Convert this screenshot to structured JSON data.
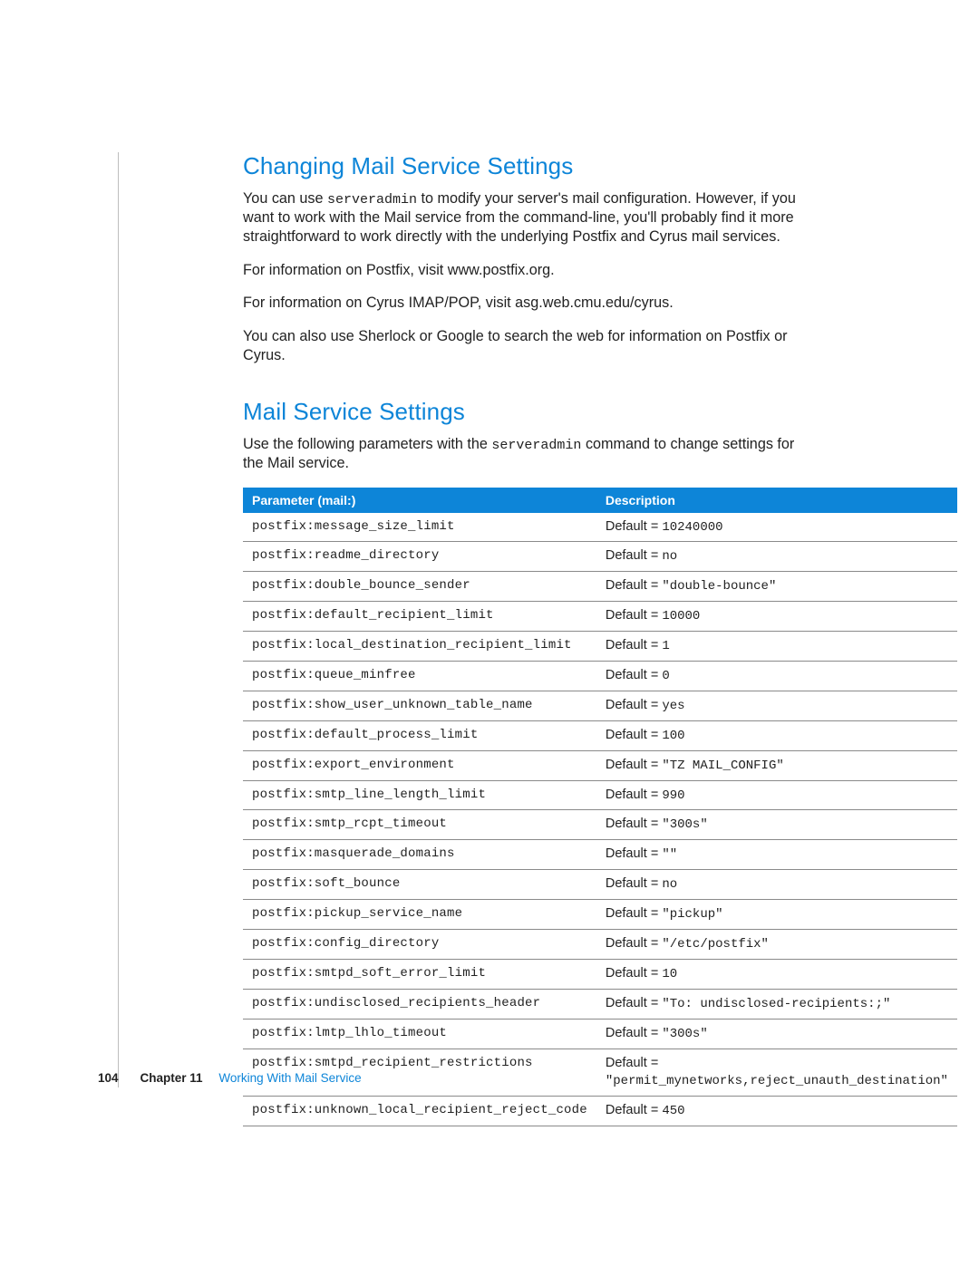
{
  "heading1": "Changing Mail Service Settings",
  "p1a": "You can use ",
  "p1_code": "serveradmin",
  "p1b": " to modify your server's mail configuration. However, if you want to work with the Mail service from the command-line, you'll probably find it more straightforward to work directly with the underlying Postfix and Cyrus mail services.",
  "p2": "For information on Postfix, visit www.postfix.org.",
  "p3": "For information on Cyrus IMAP/POP, visit asg.web.cmu.edu/cyrus.",
  "p4": "You can also use Sherlock or Google to search the web for information on Postfix or Cyrus.",
  "heading2": "Mail Service Settings",
  "p5a": "Use the following parameters with the ",
  "p5_code": "serveradmin",
  "p5b": " command to change settings for the Mail service.",
  "th_param": "Parameter (mail:)",
  "th_desc": "Description",
  "default_label": "Default = ",
  "rows": [
    {
      "param": "postfix:message_size_limit",
      "value": "10240000",
      "mono": true
    },
    {
      "param": "postfix:readme_directory",
      "value": "no",
      "mono": true
    },
    {
      "param": "postfix:double_bounce_sender",
      "value": "\"double-bounce\"",
      "mono": true
    },
    {
      "param": "postfix:default_recipient_limit",
      "value": "10000",
      "mono": true
    },
    {
      "param": "postfix:local_destination_recipient_limit",
      "value": "1",
      "mono": true
    },
    {
      "param": "postfix:queue_minfree",
      "value": "0",
      "mono": true
    },
    {
      "param": "postfix:show_user_unknown_table_name",
      "value": "yes",
      "mono": true
    },
    {
      "param": "postfix:default_process_limit",
      "value": "100",
      "mono": true
    },
    {
      "param": "postfix:export_environment",
      "value": " \"TZ MAIL_CONFIG\"",
      "mono": true
    },
    {
      "param": "postfix:smtp_line_length_limit",
      "value": "990",
      "mono": true
    },
    {
      "param": "postfix:smtp_rcpt_timeout",
      "value": "\"300s\"",
      "mono": true
    },
    {
      "param": "postfix:masquerade_domains",
      "value": "\"\"",
      "mono": true
    },
    {
      "param": "postfix:soft_bounce",
      "value": "no",
      "mono": true
    },
    {
      "param": "postfix:pickup_service_name",
      "value": "\"pickup\"",
      "mono": true
    },
    {
      "param": "postfix:config_directory",
      "value": "\"/etc/postfix\"",
      "mono": true
    },
    {
      "param": "postfix:smtpd_soft_error_limit",
      "value": "10",
      "mono": true
    },
    {
      "param": "postfix:undisclosed_recipients_header",
      "value": "\"To: undisclosed-recipients:;\"",
      "mono": true
    },
    {
      "param": "postfix:lmtp_lhlo_timeout",
      "value": "\"300s\"",
      "mono": true
    },
    {
      "param": "postfix:smtpd_recipient_restrictions",
      "value": "\"permit_mynetworks,reject_unauth_destination\"",
      "mono": true,
      "break_after_label": true
    },
    {
      "param": "postfix:unknown_local_recipient_reject_code",
      "value": "450",
      "mono": true
    }
  ],
  "footer": {
    "page": "104",
    "chapter": "Chapter 11",
    "title": "Working With Mail Service"
  }
}
